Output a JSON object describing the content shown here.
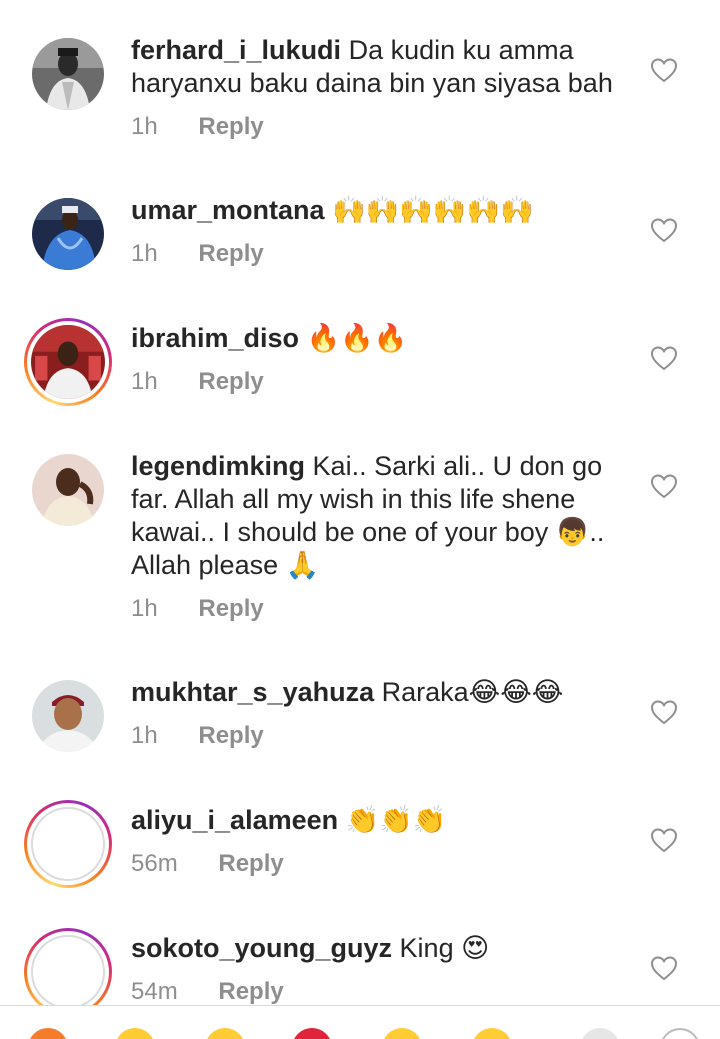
{
  "comments": [
    {
      "username": "ferhard_i_lukudi",
      "text": "Da kudin ku amma haryanxu baku daina bin yan siyasa bah",
      "time": "1h",
      "reply": "Reply"
    },
    {
      "username": "umar_montana",
      "text": "🙌🙌🙌🙌🙌🙌",
      "time": "1h",
      "reply": "Reply"
    },
    {
      "username": "ibrahim_diso",
      "text": "🔥🔥🔥",
      "time": "1h",
      "reply": "Reply"
    },
    {
      "username": "legendimking",
      "text": "Kai.. Sarki ali.. U don go far. Allah  all my wish in this life shene kawai.. I should be one of your boy 👦.. Allah please 🙏",
      "time": "1h",
      "reply": "Reply"
    },
    {
      "username": "mukhtar_s_yahuza",
      "text": "Raraka😂😂😂",
      "time": "1h",
      "reply": "Reply"
    },
    {
      "username": "aliyu_i_alameen",
      "text": "👏👏👏",
      "time": "56m",
      "reply": "Reply"
    },
    {
      "username": "sokoto_young_guyz",
      "text": "King 😍",
      "time": "54m",
      "reply": "Reply"
    }
  ],
  "icons": {
    "like": "heart-outline-icon",
    "avatar_placeholder": "profile-photo"
  },
  "colors": {
    "text": "#262626",
    "meta": "#8e8e8e",
    "story_ring_start": "#feda75",
    "story_ring_end": "#d62976"
  }
}
